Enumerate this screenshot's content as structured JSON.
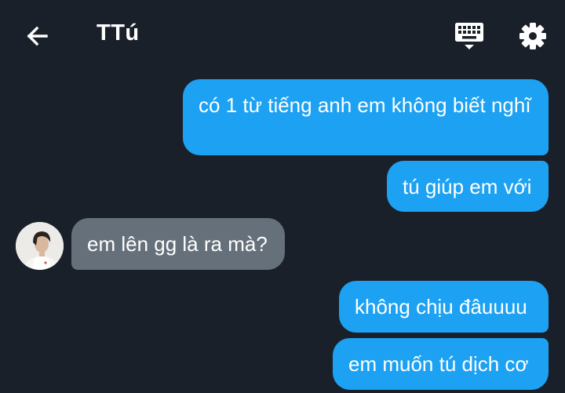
{
  "header": {
    "title": "TTú",
    "back_icon": "arrow-left-icon",
    "keyboard_icon": "keyboard-icon",
    "settings_icon": "gear-icon"
  },
  "colors": {
    "background": "#1a2029",
    "outgoing_bubble": "#1da1f2",
    "incoming_bubble": "#66707a",
    "text": "#ffffff"
  },
  "messages": [
    {
      "direction": "outgoing",
      "text": "có 1 từ tiếng anh em không biết nghĩ"
    },
    {
      "direction": "outgoing",
      "text": "tú giúp em với"
    },
    {
      "direction": "incoming",
      "text": "em lên gg là ra mà?",
      "has_avatar": true
    },
    {
      "direction": "outgoing",
      "text": "không chịu đâuuuu"
    },
    {
      "direction": "outgoing",
      "text": "em muốn tú dịch cơ"
    }
  ]
}
